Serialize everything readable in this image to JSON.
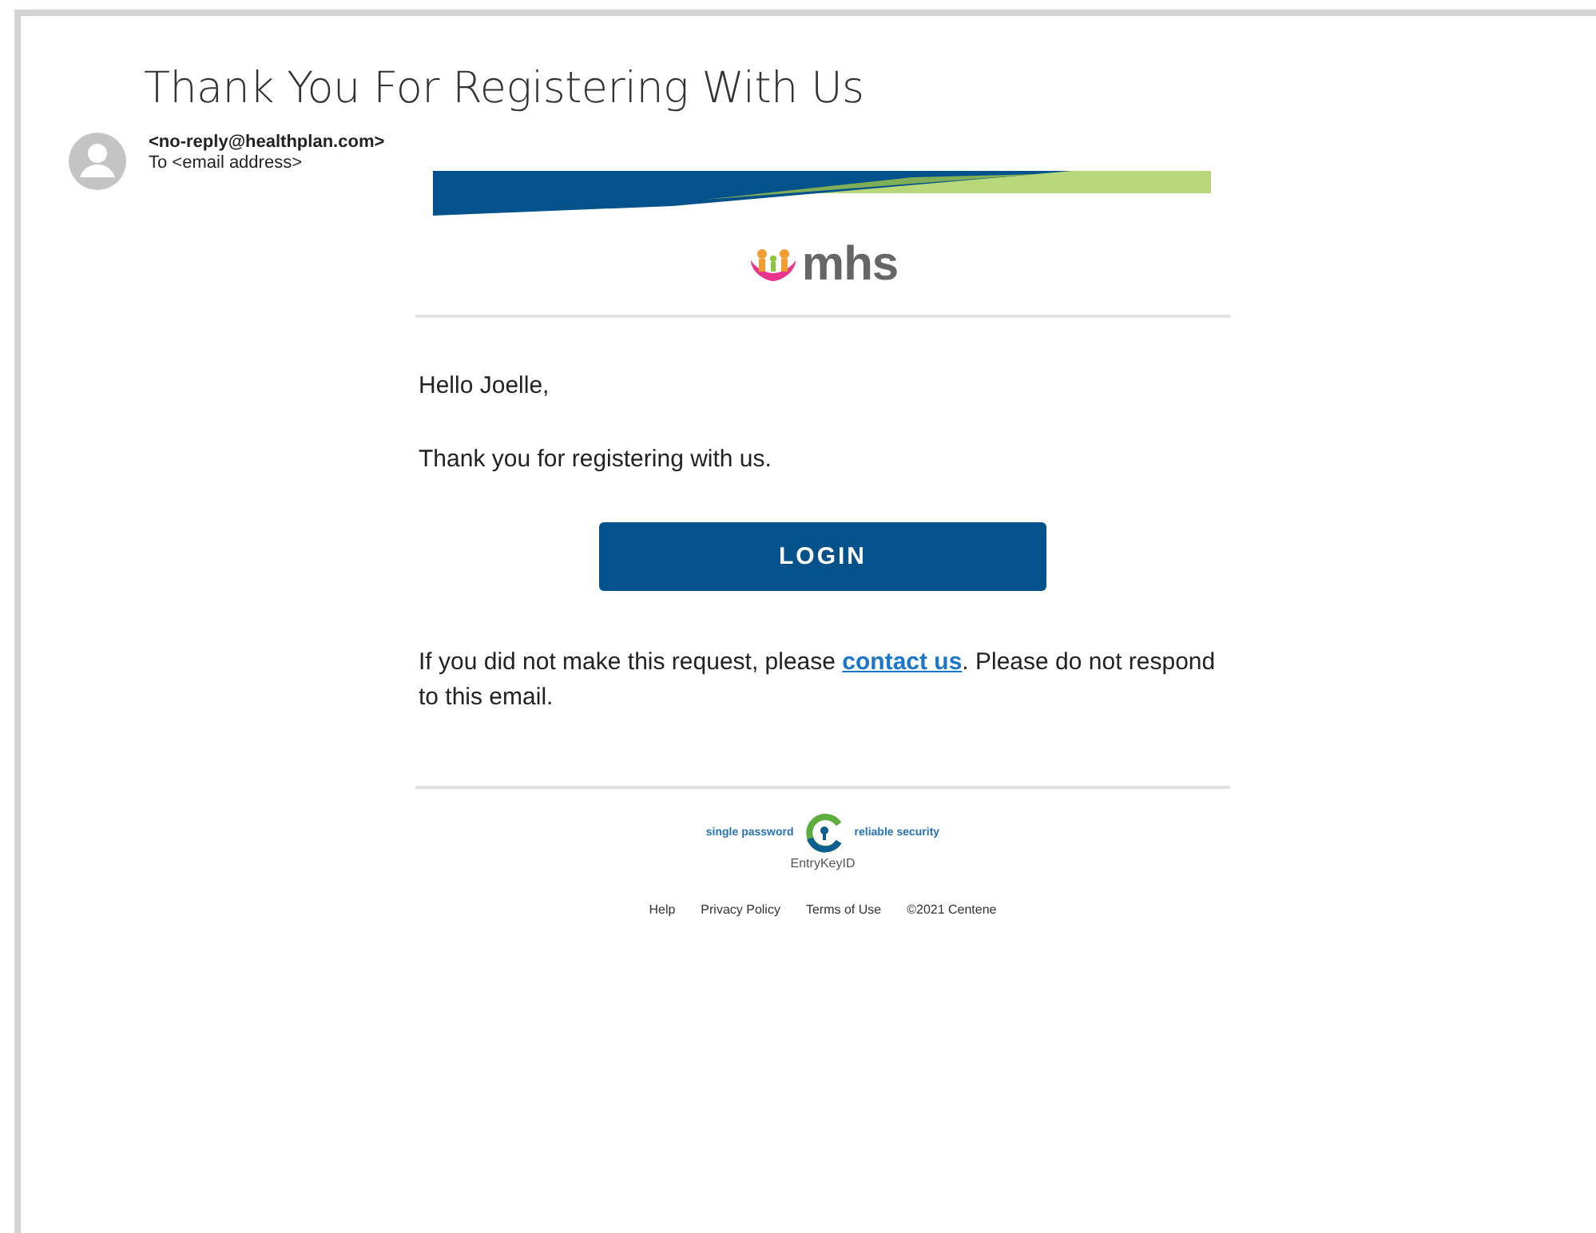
{
  "subject": "Thank You For Registering With Us",
  "sender": {
    "from": "<no-reply@healthplan.com>",
    "to": "To <email address>"
  },
  "email": {
    "brand": "mhs",
    "greeting": "Hello Joelle,",
    "message": "Thank you for registering with us.",
    "button": "LOGIN",
    "notice": {
      "before": "If you did not make this request, please ",
      "link": "contact us",
      "after": ". Please do not respond to this email."
    },
    "badge": {
      "left": "single password",
      "right": "reliable security",
      "name": "EntryKeyID"
    },
    "footer_links": [
      "Help",
      "Privacy Policy",
      "Terms of Use",
      "©2021 Centene"
    ]
  }
}
